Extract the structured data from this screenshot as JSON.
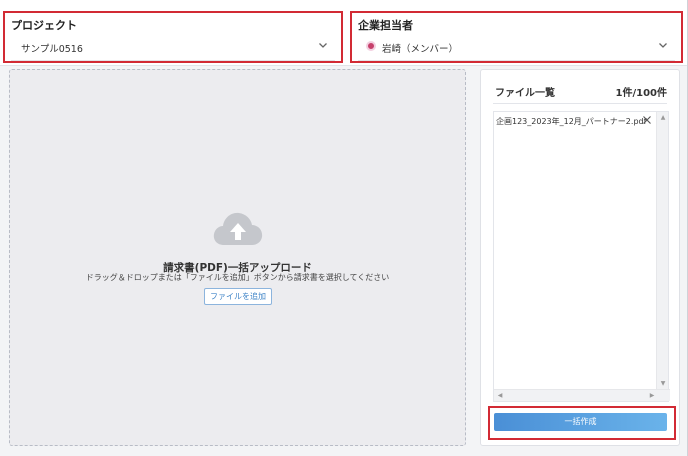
{
  "project": {
    "label": "プロジェクト",
    "value": "サンプル0516"
  },
  "assignee": {
    "label": "企業担当者",
    "value": "岩崎（メンバー）"
  },
  "upload": {
    "title": "請求書(PDF)一括アップロード",
    "hint": "ドラッグ＆ドロップまたは「ファイルを追加」ボタンから請求書を選択してください",
    "add_button": "ファイルを追加"
  },
  "file_panel": {
    "title": "ファイル一覧",
    "count": "1件/100件",
    "files": [
      {
        "name": "企画123_2023年_12月_パートナー2.pdf"
      }
    ]
  },
  "actions": {
    "bulk_create": "一括作成"
  },
  "colors": {
    "annotation": "#d22a34",
    "accent": "#4a8fd6",
    "avatar": "#c6406b"
  },
  "icons": {
    "upload": "cloud-upload-icon",
    "dropdown": "chevron-down-icon",
    "remove": "close-icon"
  }
}
